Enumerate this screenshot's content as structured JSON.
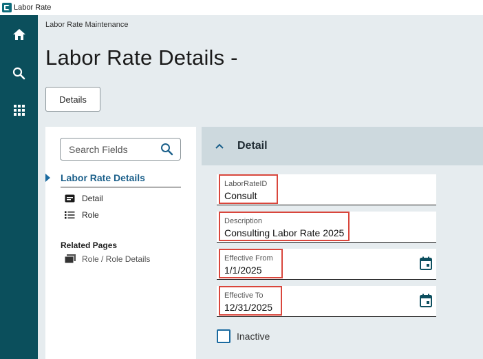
{
  "window": {
    "title": "Labor Rate"
  },
  "rail": {
    "items": [
      {
        "name": "home",
        "icon": "home-icon"
      },
      {
        "name": "search",
        "icon": "search-icon"
      },
      {
        "name": "apps",
        "icon": "grid-icon"
      }
    ]
  },
  "header": {
    "breadcrumb": "Labor Rate Maintenance",
    "title": "Labor Rate Details -",
    "details_button": "Details"
  },
  "nav": {
    "search_placeholder": "Search Fields",
    "section_title": "Labor Rate Details",
    "items": [
      {
        "label": "Detail",
        "icon": "detail-card-icon"
      },
      {
        "label": "Role",
        "icon": "list-icon"
      }
    ],
    "related_title": "Related Pages",
    "related_items": [
      {
        "label": "Role / Role Details",
        "icon": "pages-icon"
      }
    ]
  },
  "detail": {
    "section_label": "Detail",
    "fields": [
      {
        "label": "LaborRateID",
        "value": "Consult"
      },
      {
        "label": "Description",
        "value": "Consulting Labor Rate 2025"
      },
      {
        "label": "Effective From",
        "value": "1/1/2025"
      },
      {
        "label": "Effective To",
        "value": "12/31/2025"
      }
    ],
    "checkbox": {
      "label": "Inactive",
      "checked": false
    }
  },
  "colors": {
    "rail": "#0b4f5c",
    "accent": "#1a6aa0",
    "highlight": "#d9463c",
    "section_header": "#cdd9de"
  }
}
